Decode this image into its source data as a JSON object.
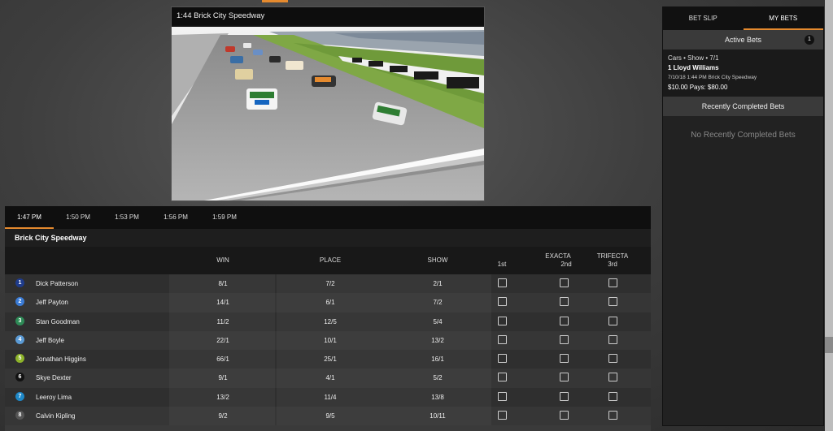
{
  "video": {
    "title": "1:44 Brick City Speedway"
  },
  "race": {
    "times": [
      "1:47 PM",
      "1:50 PM",
      "1:53 PM",
      "1:56 PM",
      "1:59 PM"
    ],
    "active_time_index": 0,
    "track_name": "Brick City Speedway",
    "headers": {
      "win": "WIN",
      "place": "PLACE",
      "show": "SHOW",
      "first": "1st",
      "exacta": "EXACTA",
      "second": "2nd",
      "trifecta": "TRIFECTA",
      "third": "3rd"
    },
    "runners": [
      {
        "number": "1",
        "color": "#1f3c8c",
        "name": "Dick Patterson",
        "win": "8/1",
        "place": "7/2",
        "show": "2/1"
      },
      {
        "number": "2",
        "color": "#3a7bd5",
        "name": "Jeff Payton",
        "win": "14/1",
        "place": "6/1",
        "show": "7/2"
      },
      {
        "number": "3",
        "color": "#2e8b57",
        "name": "Stan Goodman",
        "win": "11/2",
        "place": "12/5",
        "show": "5/4"
      },
      {
        "number": "4",
        "color": "#5b9bd5",
        "name": "Jeff Boyle",
        "win": "22/1",
        "place": "10/1",
        "show": "13/2"
      },
      {
        "number": "5",
        "color": "#8db32a",
        "name": "Jonathan Higgins",
        "win": "66/1",
        "place": "25/1",
        "show": "16/1"
      },
      {
        "number": "6",
        "color": "#111111",
        "name": "Skye Dexter",
        "win": "9/1",
        "place": "4/1",
        "show": "5/2"
      },
      {
        "number": "7",
        "color": "#1e88c8",
        "name": "Leeroy Lima",
        "win": "13/2",
        "place": "11/4",
        "show": "13/8"
      },
      {
        "number": "8",
        "color": "#555555",
        "name": "Calvin Kipling",
        "win": "9/2",
        "place": "9/5",
        "show": "10/11"
      }
    ]
  },
  "sidebar": {
    "tabs": [
      "BET SLIP",
      "MY BETS"
    ],
    "active_tab_index": 1,
    "active_bets_label": "Active Bets",
    "active_bets_count": "1",
    "bet": {
      "line1": "Cars • Show • 7/1",
      "line2": "1 Lloyd Williams",
      "line3": "7/10/18 1:44 PM Brick City Speedway",
      "line4": "$10.00 Pays: $80.00"
    },
    "completed_label": "Recently Completed Bets",
    "completed_empty": "No Recently Completed Bets"
  },
  "colors": {
    "accent": "#e58a2e",
    "panel": "#222222"
  }
}
